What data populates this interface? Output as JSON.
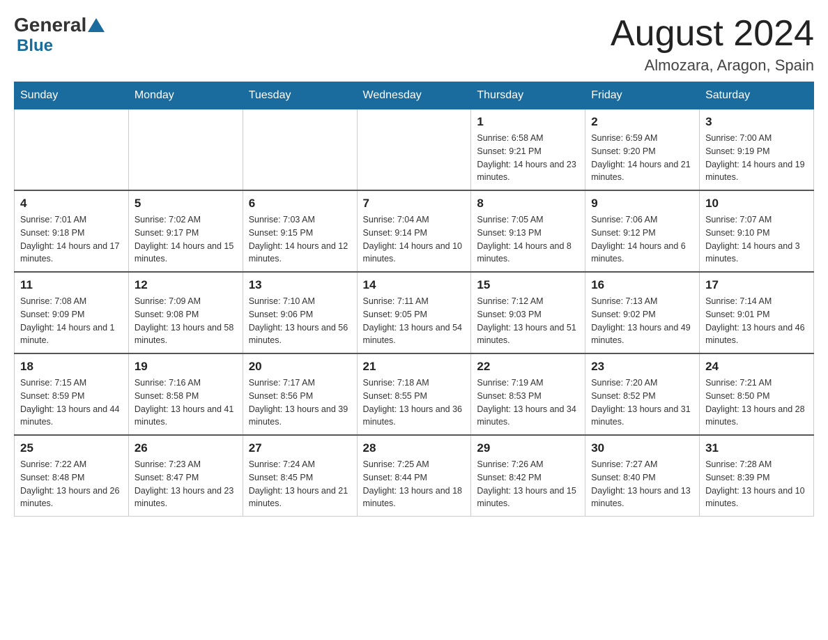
{
  "logo": {
    "text_general": "General",
    "text_blue": "Blue"
  },
  "title": {
    "month_year": "August 2024",
    "location": "Almozara, Aragon, Spain"
  },
  "weekdays": [
    "Sunday",
    "Monday",
    "Tuesday",
    "Wednesday",
    "Thursday",
    "Friday",
    "Saturday"
  ],
  "weeks": [
    [
      {
        "day": "",
        "info": ""
      },
      {
        "day": "",
        "info": ""
      },
      {
        "day": "",
        "info": ""
      },
      {
        "day": "",
        "info": ""
      },
      {
        "day": "1",
        "info": "Sunrise: 6:58 AM\nSunset: 9:21 PM\nDaylight: 14 hours and 23 minutes."
      },
      {
        "day": "2",
        "info": "Sunrise: 6:59 AM\nSunset: 9:20 PM\nDaylight: 14 hours and 21 minutes."
      },
      {
        "day": "3",
        "info": "Sunrise: 7:00 AM\nSunset: 9:19 PM\nDaylight: 14 hours and 19 minutes."
      }
    ],
    [
      {
        "day": "4",
        "info": "Sunrise: 7:01 AM\nSunset: 9:18 PM\nDaylight: 14 hours and 17 minutes."
      },
      {
        "day": "5",
        "info": "Sunrise: 7:02 AM\nSunset: 9:17 PM\nDaylight: 14 hours and 15 minutes."
      },
      {
        "day": "6",
        "info": "Sunrise: 7:03 AM\nSunset: 9:15 PM\nDaylight: 14 hours and 12 minutes."
      },
      {
        "day": "7",
        "info": "Sunrise: 7:04 AM\nSunset: 9:14 PM\nDaylight: 14 hours and 10 minutes."
      },
      {
        "day": "8",
        "info": "Sunrise: 7:05 AM\nSunset: 9:13 PM\nDaylight: 14 hours and 8 minutes."
      },
      {
        "day": "9",
        "info": "Sunrise: 7:06 AM\nSunset: 9:12 PM\nDaylight: 14 hours and 6 minutes."
      },
      {
        "day": "10",
        "info": "Sunrise: 7:07 AM\nSunset: 9:10 PM\nDaylight: 14 hours and 3 minutes."
      }
    ],
    [
      {
        "day": "11",
        "info": "Sunrise: 7:08 AM\nSunset: 9:09 PM\nDaylight: 14 hours and 1 minute."
      },
      {
        "day": "12",
        "info": "Sunrise: 7:09 AM\nSunset: 9:08 PM\nDaylight: 13 hours and 58 minutes."
      },
      {
        "day": "13",
        "info": "Sunrise: 7:10 AM\nSunset: 9:06 PM\nDaylight: 13 hours and 56 minutes."
      },
      {
        "day": "14",
        "info": "Sunrise: 7:11 AM\nSunset: 9:05 PM\nDaylight: 13 hours and 54 minutes."
      },
      {
        "day": "15",
        "info": "Sunrise: 7:12 AM\nSunset: 9:03 PM\nDaylight: 13 hours and 51 minutes."
      },
      {
        "day": "16",
        "info": "Sunrise: 7:13 AM\nSunset: 9:02 PM\nDaylight: 13 hours and 49 minutes."
      },
      {
        "day": "17",
        "info": "Sunrise: 7:14 AM\nSunset: 9:01 PM\nDaylight: 13 hours and 46 minutes."
      }
    ],
    [
      {
        "day": "18",
        "info": "Sunrise: 7:15 AM\nSunset: 8:59 PM\nDaylight: 13 hours and 44 minutes."
      },
      {
        "day": "19",
        "info": "Sunrise: 7:16 AM\nSunset: 8:58 PM\nDaylight: 13 hours and 41 minutes."
      },
      {
        "day": "20",
        "info": "Sunrise: 7:17 AM\nSunset: 8:56 PM\nDaylight: 13 hours and 39 minutes."
      },
      {
        "day": "21",
        "info": "Sunrise: 7:18 AM\nSunset: 8:55 PM\nDaylight: 13 hours and 36 minutes."
      },
      {
        "day": "22",
        "info": "Sunrise: 7:19 AM\nSunset: 8:53 PM\nDaylight: 13 hours and 34 minutes."
      },
      {
        "day": "23",
        "info": "Sunrise: 7:20 AM\nSunset: 8:52 PM\nDaylight: 13 hours and 31 minutes."
      },
      {
        "day": "24",
        "info": "Sunrise: 7:21 AM\nSunset: 8:50 PM\nDaylight: 13 hours and 28 minutes."
      }
    ],
    [
      {
        "day": "25",
        "info": "Sunrise: 7:22 AM\nSunset: 8:48 PM\nDaylight: 13 hours and 26 minutes."
      },
      {
        "day": "26",
        "info": "Sunrise: 7:23 AM\nSunset: 8:47 PM\nDaylight: 13 hours and 23 minutes."
      },
      {
        "day": "27",
        "info": "Sunrise: 7:24 AM\nSunset: 8:45 PM\nDaylight: 13 hours and 21 minutes."
      },
      {
        "day": "28",
        "info": "Sunrise: 7:25 AM\nSunset: 8:44 PM\nDaylight: 13 hours and 18 minutes."
      },
      {
        "day": "29",
        "info": "Sunrise: 7:26 AM\nSunset: 8:42 PM\nDaylight: 13 hours and 15 minutes."
      },
      {
        "day": "30",
        "info": "Sunrise: 7:27 AM\nSunset: 8:40 PM\nDaylight: 13 hours and 13 minutes."
      },
      {
        "day": "31",
        "info": "Sunrise: 7:28 AM\nSunset: 8:39 PM\nDaylight: 13 hours and 10 minutes."
      }
    ]
  ]
}
